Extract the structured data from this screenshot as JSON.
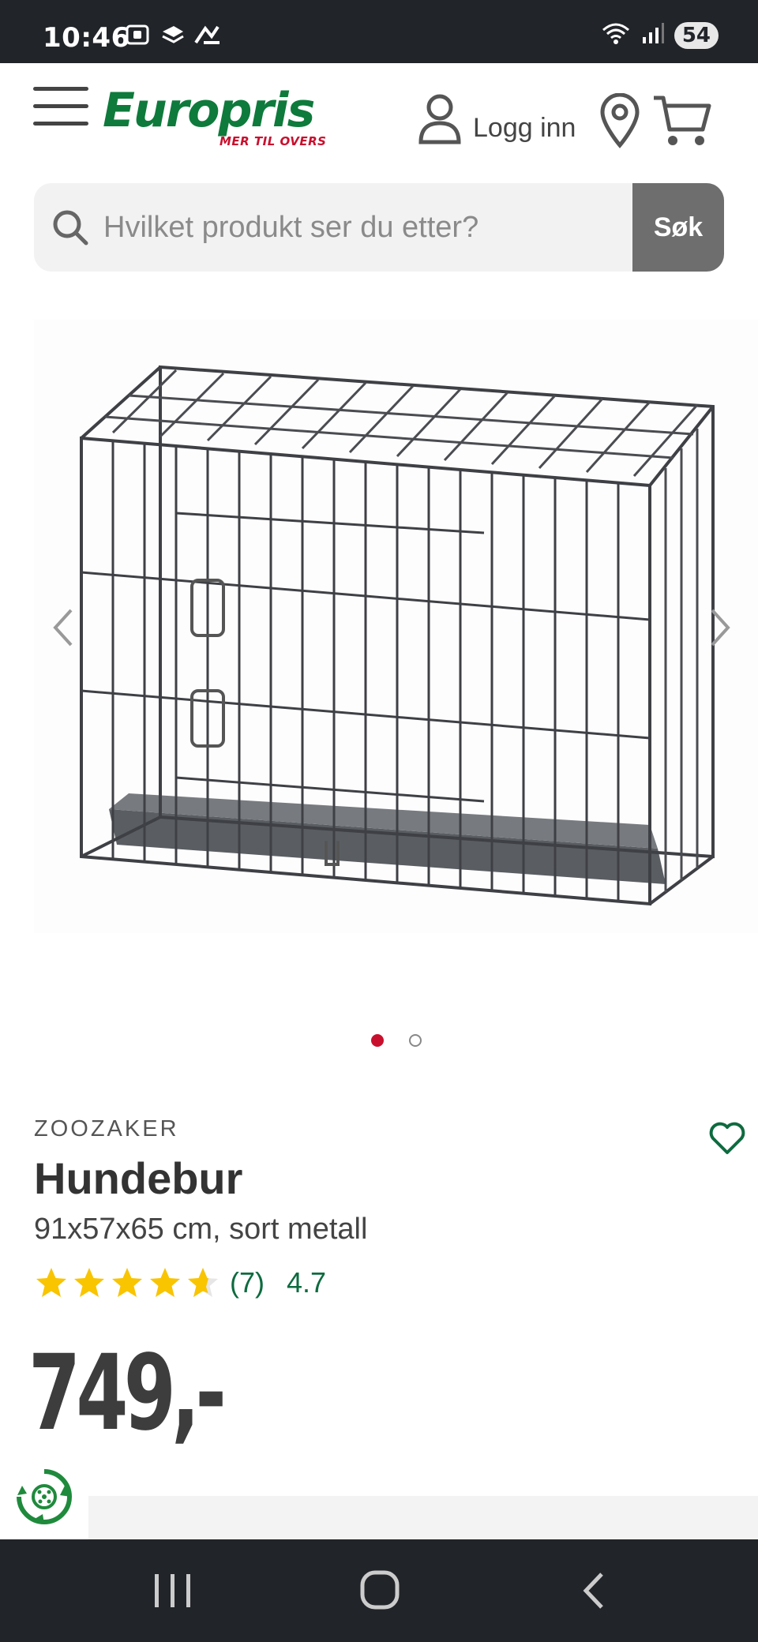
{
  "status_bar": {
    "time": "10:46",
    "battery": "54"
  },
  "header": {
    "logo_text": "Europris",
    "logo_tagline": "MER TIL OVERS",
    "login_label": "Logg inn"
  },
  "search": {
    "placeholder": "Hvilket produkt ser du etter?",
    "button_label": "Søk"
  },
  "carousel": {
    "current_slide": 1,
    "total_slides": 2
  },
  "product": {
    "brand": "ZOOZAKER",
    "title": "Hundebur",
    "subtitle": "91x57x65 cm, sort metall",
    "rating_count": "(7)",
    "rating_avg": "4.7",
    "rating_value": 4.7,
    "price": "749,-"
  },
  "colors": {
    "brand_green": "#0e7a3b",
    "brand_red": "#c8102e",
    "star": "#f9c400",
    "rating_text": "#0e6b3f",
    "bars": "#212429"
  },
  "icons": {
    "menu": "hamburger-icon",
    "user": "user-icon",
    "location": "location-pin-icon",
    "cart": "cart-icon",
    "search": "search-icon",
    "favorite": "heart-icon",
    "eco": "recycle-icon"
  }
}
